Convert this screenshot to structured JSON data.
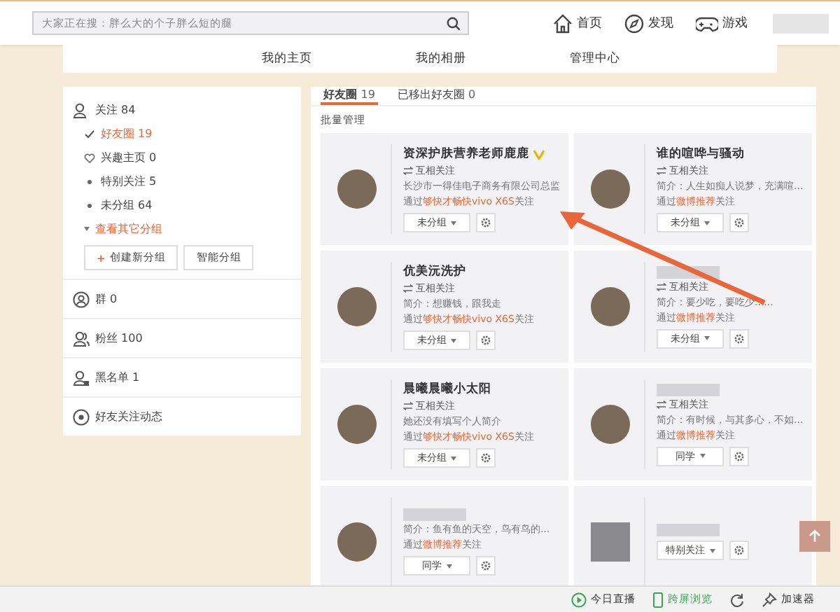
{
  "header": {
    "search": {
      "placeholder": "大家正在搜：胖么大的个子胖么短的腿"
    },
    "nav": [
      {
        "label": "首页",
        "kind": "home"
      },
      {
        "label": "发现",
        "kind": "discover"
      },
      {
        "label": "游戏",
        "kind": "game"
      }
    ]
  },
  "subnav": [
    "我的主页",
    "我的相册",
    "管理中心"
  ],
  "sidebar": {
    "follow": {
      "label": "关注",
      "count": "84"
    },
    "groups": [
      {
        "label": "好友圈",
        "count": "19",
        "kind": "check",
        "selected": true
      },
      {
        "label": "兴趣主页",
        "count": "0",
        "kind": "heart",
        "selected": false
      },
      {
        "label": "特别关注",
        "count": "5",
        "kind": "dot",
        "selected": false
      },
      {
        "label": "未分组",
        "count": "64",
        "kind": "dot",
        "selected": false
      }
    ],
    "more": "查看其它分组",
    "buttons": [
      {
        "label": "创建新分组",
        "icon": "+"
      },
      {
        "label": "智能分组"
      }
    ],
    "sections": [
      {
        "label": "群",
        "count": "0",
        "kind": "group"
      },
      {
        "label": "粉丝",
        "count": "100",
        "kind": "fans"
      },
      {
        "label": "黑名单",
        "count": "1",
        "kind": "block"
      },
      {
        "label": "好友关注动态",
        "kind": "feed"
      }
    ]
  },
  "tabs": [
    {
      "label": "好友圈",
      "count": "19",
      "selected": true
    },
    {
      "label": "已移出好友圈",
      "count": "0",
      "selected": false
    }
  ],
  "batch": "批量管理",
  "cards": [
    {
      "name": "资深护肤营养老师鹿鹿",
      "verified": true,
      "mutual": "互相关注",
      "bio": "长沙市一得佳电子商务有限公司总监",
      "via": [
        "通过",
        "够快才畅快vivo X6S",
        "关注"
      ],
      "group": "未分组",
      "kind": "round"
    },
    {
      "name": "谁的喧哗与骚动",
      "verified": false,
      "mutual": "互相关注",
      "bio": "简介：人生如痴人说梦，充满喧...",
      "via": [
        "通过",
        "微博推荐",
        "关注"
      ],
      "group": "未分组",
      "kind": "round"
    },
    {
      "name": "伉美沅洗护",
      "verified": false,
      "mutual": "互相关注",
      "bio": "简介：想赚钱，跟我走",
      "via": [
        "通过",
        "够快才畅快vivo X6S",
        "关注"
      ],
      "group": "未分组",
      "kind": "round"
    },
    {
      "verified": false,
      "mutual": "互相关注",
      "bio": "简介：要少吃，要吃少......",
      "via": [
        "通过",
        "微博推荐",
        "关注"
      ],
      "group": "未分组",
      "kind": "round"
    },
    {
      "name": "晨曦晨曦小太阳",
      "verified": false,
      "mutual": "互相关注",
      "bio": "她还没有填写个人简介",
      "via": [
        "通过",
        "够快才畅快vivo X6S",
        "关注"
      ],
      "group": "未分组",
      "kind": "round"
    },
    {
      "verified": false,
      "mutual": "互相关注",
      "bio": "简介：有时候，与其多心，不如...",
      "via": [
        "通过",
        "微博推荐",
        "关注"
      ],
      "group": "同学",
      "kind": "round"
    },
    {
      "verified": false,
      "bio": "简介：鱼有鱼的天空，鸟有鸟的...",
      "via": [
        "通过",
        "微博推荐",
        "关注"
      ],
      "group": "同学",
      "kind": "round"
    },
    {
      "verified": false,
      "group": "特别关注",
      "kind": "square"
    }
  ],
  "status_bar": [
    {
      "label": "今日直播",
      "kind": "live"
    },
    {
      "label": "跨屏浏览",
      "kind": "phone"
    },
    {
      "kind": "refresh"
    },
    {
      "label": "加速器",
      "kind": "pin"
    }
  ]
}
